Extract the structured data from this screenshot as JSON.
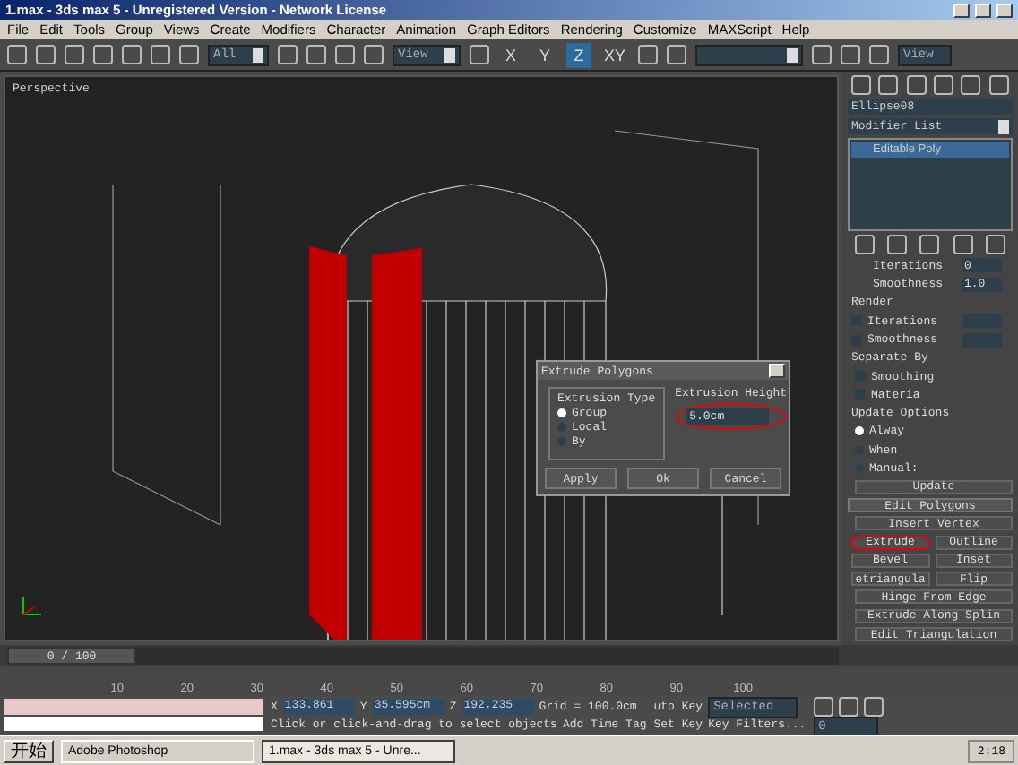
{
  "window": {
    "title": "1.max - 3ds max 5 - Unregistered Version - Network License"
  },
  "menu": [
    "File",
    "Edit",
    "Tools",
    "Group",
    "Views",
    "Create",
    "Modifiers",
    "Character",
    "Animation",
    "Graph Editors",
    "Rendering",
    "Customize",
    "MAXScript",
    "Help"
  ],
  "toolbar": {
    "selection_filter": "All",
    "coord_system": "View",
    "axes": [
      {
        "label": "X",
        "selected": false
      },
      {
        "label": "Y",
        "selected": false
      },
      {
        "label": "Z",
        "selected": true
      },
      {
        "label": "XY",
        "selected": false
      }
    ],
    "view": "View"
  },
  "viewport": {
    "label": "Perspective"
  },
  "dialog": {
    "title": "Extrude Polygons",
    "group_title": "Extrusion Type",
    "options": [
      {
        "label": "Group",
        "selected": true
      },
      {
        "label": "Local",
        "selected": false
      },
      {
        "label": "By",
        "selected": false
      }
    ],
    "height_label": "Extrusion Height",
    "height_value": "5.0cm",
    "height_highlighted": true,
    "buttons": [
      "Apply",
      "Ok",
      "Cancel"
    ]
  },
  "command_panel": {
    "object_name": "Ellipse08",
    "modifier_list": "Modifier List",
    "stack": [
      {
        "label": "Editable Poly",
        "selected": true
      }
    ],
    "rows": [
      {
        "kind": "spinner",
        "label": "Iterations",
        "value": "0"
      },
      {
        "kind": "spinner",
        "label": "Smoothness",
        "value": "1.0"
      },
      {
        "kind": "heading",
        "label": "Render"
      },
      {
        "kind": "check_spinner",
        "label": "Iterations",
        "checked": false
      },
      {
        "kind": "check_spinner",
        "label": "Smoothness",
        "checked": false
      },
      {
        "kind": "heading",
        "label": "Separate By"
      },
      {
        "kind": "checkbox",
        "label": "Smoothing",
        "checked": false
      },
      {
        "kind": "checkbox",
        "label": "Materia",
        "checked": false
      },
      {
        "kind": "heading",
        "label": "Update Options"
      },
      {
        "kind": "radio",
        "label": "Alway",
        "selected": true
      },
      {
        "kind": "radio",
        "label": "When",
        "selected": false
      },
      {
        "kind": "radio",
        "label": "Manual:",
        "selected": false
      },
      {
        "kind": "button",
        "label": "Update"
      },
      {
        "kind": "title_bar",
        "label": "Edit Polygons"
      },
      {
        "kind": "button",
        "label": "Insert Vertex"
      },
      {
        "kind": "button_pair",
        "buttons": [
          {
            "label": "Extrude",
            "highlighted": true
          },
          {
            "label": "Outline",
            "highlighted": false
          }
        ]
      },
      {
        "kind": "button_pair",
        "buttons": [
          {
            "label": "Bevel",
            "highlighted": false
          },
          {
            "label": "Inset",
            "highlighted": false
          }
        ]
      },
      {
        "kind": "button_pair",
        "buttons": [
          {
            "label": "etriangula",
            "highlighted": false
          },
          {
            "label": "Flip",
            "highlighted": false
          }
        ]
      },
      {
        "kind": "button",
        "label": "Hinge From Edge"
      },
      {
        "kind": "button",
        "label": "Extrude Along Splin"
      },
      {
        "kind": "button",
        "label": "Edit Triangulation"
      }
    ]
  },
  "time_slider": {
    "frame": "0 / 100",
    "level": 0
  },
  "track_ticks": [
    "10",
    "20",
    "30",
    "40",
    "50",
    "60",
    "70",
    "80",
    "90",
    "100"
  ],
  "status": {
    "coords": [
      {
        "axis": "X",
        "value": "133.861"
      },
      {
        "axis": "Y",
        "value": "35.595cm"
      },
      {
        "axis": "Z",
        "value": "192.235"
      }
    ],
    "grid": "Grid = 100.0cm",
    "prompt": "Click or click-and-drag to select objects",
    "time_tag": "Add Time Tag",
    "auto_key": "uto Key",
    "key_mode": "Selected",
    "set_key": "Set Key",
    "key_filters": "Key Filters...",
    "frame": "0"
  },
  "taskbar": {
    "start": "开始",
    "tasks": [
      {
        "label": "Adobe Photoshop",
        "selected": false
      },
      {
        "label": "1.max - 3ds max 5 - Unre...",
        "selected": true
      }
    ],
    "clock": "2:18"
  }
}
